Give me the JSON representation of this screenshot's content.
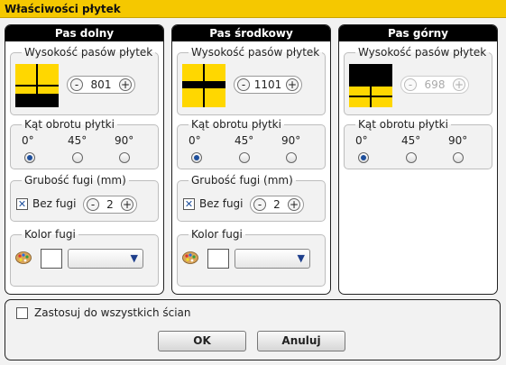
{
  "window": {
    "title": "Właściwości płytek"
  },
  "colors": {
    "accent": "#f5c800",
    "tile_yellow": "#ffd700",
    "tile_black": "#000000",
    "radio_dot": "#1e4f9c"
  },
  "panels": [
    {
      "title": "Pas dolny",
      "height_section": {
        "label": "Wysokość pasów płytek",
        "value": "801",
        "enabled": true
      },
      "rotation": {
        "label": "Kąt obrotu płytki",
        "options": [
          "0°",
          "45°",
          "90°"
        ],
        "selected": "0°"
      },
      "grout_width": {
        "label": "Grubość fugi (mm)",
        "no_grout_label": "Bez fugi",
        "no_grout_checked": true,
        "value": "2"
      },
      "grout_color": {
        "label": "Kolor fugi",
        "color": "#ffffff",
        "selected_option": ""
      }
    },
    {
      "title": "Pas środkowy",
      "height_section": {
        "label": "Wysokość pasów płytek",
        "value": "1101",
        "enabled": true
      },
      "rotation": {
        "label": "Kąt obrotu płytki",
        "options": [
          "0°",
          "45°",
          "90°"
        ],
        "selected": "0°"
      },
      "grout_width": {
        "label": "Grubość fugi (mm)",
        "no_grout_label": "Bez fugi",
        "no_grout_checked": true,
        "value": "2"
      },
      "grout_color": {
        "label": "Kolor fugi",
        "color": "#ffffff",
        "selected_option": ""
      }
    },
    {
      "title": "Pas górny",
      "height_section": {
        "label": "Wysokość pasów płytek",
        "value": "698",
        "enabled": false
      },
      "rotation": {
        "label": "Kąt obrotu płytki",
        "options": [
          "0°",
          "45°",
          "90°"
        ],
        "selected": "0°"
      }
    }
  ],
  "footer": {
    "apply_all_label": "Zastosuj do wszystkich ścian",
    "apply_all_checked": false,
    "ok_label": "OK",
    "cancel_label": "Anuluj"
  },
  "glyphs": {
    "minus": "-",
    "plus": "+",
    "check": "✕",
    "dropdown": "▼"
  }
}
